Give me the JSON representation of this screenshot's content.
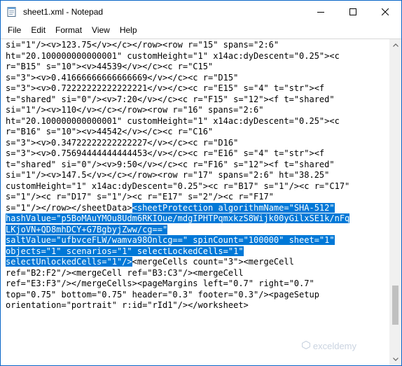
{
  "window": {
    "title": "sheet1.xml - Notepad",
    "accent_color": "#0078d7"
  },
  "menu": {
    "items": [
      "File",
      "Edit",
      "Format",
      "View",
      "Help"
    ]
  },
  "editor": {
    "lines": [
      [
        {
          "t": "si=\"1\"/><v>123.75</v></c></row><row r=\"15\" spans=\"2:6\"",
          "s": false
        }
      ],
      [
        {
          "t": "ht=\"20.100000000000001\" customHeight=\"1\" x14ac:dyDescent=\"0.25\"><c",
          "s": false
        }
      ],
      [
        {
          "t": "r=\"B15\" s=\"10\"><v>44539</v></c><c r=\"C15\"",
          "s": false
        }
      ],
      [
        {
          "t": "s=\"3\"><v>0.41666666666666669</v></c><c r=\"D15\"",
          "s": false
        }
      ],
      [
        {
          "t": "s=\"3\"><v>0.72222222222222221</v></c><c r=\"E15\" s=\"4\" t=\"str\"><f",
          "s": false
        }
      ],
      [
        {
          "t": "t=\"shared\" si=\"0\"/><v>7:20</v></c><c r=\"F15\" s=\"12\"><f t=\"shared\"",
          "s": false
        }
      ],
      [
        {
          "t": "si=\"1\"/><v>110</v></c></row><row r=\"16\" spans=\"2:6\"",
          "s": false
        }
      ],
      [
        {
          "t": "ht=\"20.100000000000001\" customHeight=\"1\" x14ac:dyDescent=\"0.25\"><c",
          "s": false
        }
      ],
      [
        {
          "t": "r=\"B16\" s=\"10\"><v>44542</v></c><c r=\"C16\"",
          "s": false
        }
      ],
      [
        {
          "t": "s=\"3\"><v>0.34722222222222227</v></c><c r=\"D16\"",
          "s": false
        }
      ],
      [
        {
          "t": "s=\"3\"><v>0.75694444444444453</v></c><c r=\"E16\" s=\"4\" t=\"str\"><f",
          "s": false
        }
      ],
      [
        {
          "t": "t=\"shared\" si=\"0\"/><v>9:50</v></c><c r=\"F16\" s=\"12\"><f t=\"shared\"",
          "s": false
        }
      ],
      [
        {
          "t": "si=\"1\"/><v>147.5</v></c></row><row r=\"17\" spans=\"2:6\" ht=\"38.25\"",
          "s": false
        }
      ],
      [
        {
          "t": "customHeight=\"1\" x14ac:dyDescent=\"0.25\"><c r=\"B17\" s=\"1\"/><c r=\"C17\"",
          "s": false
        }
      ],
      [
        {
          "t": "s=\"1\"/><c r=\"D17\" s=\"1\"/><c r=\"E17\" s=\"2\"/><c r=\"F17\"",
          "s": false
        }
      ],
      [
        {
          "t": "s=\"1\"/></row></sheetData>",
          "s": false
        },
        {
          "t": "<sheetProtection algorithmName=\"SHA-512\"",
          "s": true
        }
      ],
      [
        {
          "t": "hashValue=\"p5BoMAuYMOu8Udm6RKIOue/mdgIPHTPqmxkzS8Wijk00yGilxSE1k/nFq",
          "s": true
        }
      ],
      [
        {
          "t": "LKjoVN+QD8mhDCY+G7BgbyjZww/cg==\"",
          "s": true
        }
      ],
      [
        {
          "t": "saltValue=\"ufbvceFLW/wamva98Onlcg==\" spinCount=\"100000\" sheet=\"1\"",
          "s": true
        }
      ],
      [
        {
          "t": "objects=\"1\" scenarios=\"1\" selectLockedCells=\"1\"",
          "s": true
        }
      ],
      [
        {
          "t": "selectUnlockedCells=\"1\"/>",
          "s": true
        },
        {
          "t": "<mergeCells count=\"3\"><mergeCell",
          "s": false
        }
      ],
      [
        {
          "t": "ref=\"B2:F2\"/><mergeCell ref=\"B3:C3\"/><mergeCell",
          "s": false
        }
      ],
      [
        {
          "t": "ref=\"E3:F3\"/></mergeCells><pageMargins left=\"0.7\" right=\"0.7\"",
          "s": false
        }
      ],
      [
        {
          "t": "top=\"0.75\" bottom=\"0.75\" header=\"0.3\" footer=\"0.3\"/><pageSetup",
          "s": false
        }
      ],
      [
        {
          "t": "orientation=\"portrait\" r:id=\"rId1\"/></worksheet>",
          "s": false
        }
      ]
    ]
  },
  "watermark": {
    "text": "exceldemy"
  }
}
